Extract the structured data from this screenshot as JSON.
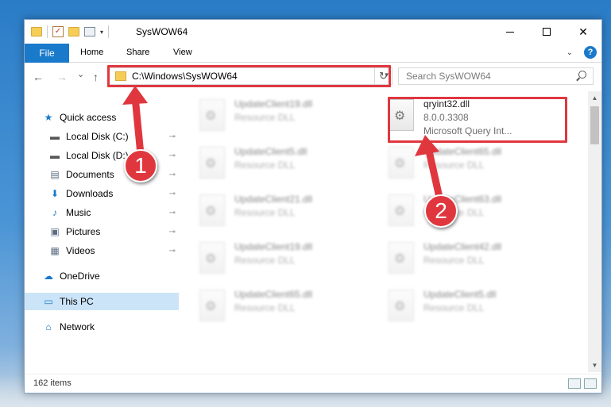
{
  "window": {
    "title": "SysWOW64",
    "minimize_glyph": "—",
    "close_glyph": "✕"
  },
  "ribbon": {
    "tabs": [
      "File",
      "Home",
      "Share",
      "View"
    ],
    "help_label": "?"
  },
  "address_bar": {
    "path": "C:\\Windows\\SysWOW64",
    "refresh_glyph": "↻"
  },
  "nav": {
    "back_glyph": "←",
    "forward_glyph": "→",
    "recent_glyph": "⌄",
    "up_glyph": "↑"
  },
  "search": {
    "placeholder": "Search SysWOW64"
  },
  "sidebar": {
    "items": [
      {
        "label": "Quick access",
        "icon": "star-icon",
        "glyph": "★",
        "color": "#1979ca",
        "pinned": false
      },
      {
        "label": "Local Disk (C:)",
        "icon": "drive-icon",
        "glyph": "▬",
        "color": "#555555",
        "pinned": true
      },
      {
        "label": "Local Disk (D:)",
        "icon": "drive-icon",
        "glyph": "▬",
        "color": "#555555",
        "pinned": true
      },
      {
        "label": "Documents",
        "icon": "documents-icon",
        "glyph": "▤",
        "color": "#5a6e82",
        "pinned": true
      },
      {
        "label": "Downloads",
        "icon": "downloads-icon",
        "glyph": "⬇",
        "color": "#1979ca",
        "pinned": true
      },
      {
        "label": "Music",
        "icon": "music-icon",
        "glyph": "♪",
        "color": "#1979ca",
        "pinned": true
      },
      {
        "label": "Pictures",
        "icon": "pictures-icon",
        "glyph": "▣",
        "color": "#5a6e82",
        "pinned": true
      },
      {
        "label": "Videos",
        "icon": "videos-icon",
        "glyph": "▦",
        "color": "#5a6e82",
        "pinned": true
      },
      {
        "label": "OneDrive",
        "icon": "onedrive-icon",
        "glyph": "☁",
        "color": "#1979ca",
        "pinned": false
      },
      {
        "label": "This PC",
        "icon": "this-pc-icon",
        "glyph": "▭",
        "color": "#1979ca",
        "pinned": false
      },
      {
        "label": "Network",
        "icon": "network-icon",
        "glyph": "⌂",
        "color": "#1979ca",
        "pinned": false
      }
    ],
    "pin_glyph": "📌"
  },
  "files": [
    {
      "name": "UpdateClient19.dll",
      "line2": "Resource DLL",
      "line3": "",
      "blurred": true
    },
    {
      "name": "qryint32.dll",
      "line2": "8.0.0.3308",
      "line3": "Microsoft Query Int...",
      "blurred": false
    },
    {
      "name": "UpdateClient5.dll",
      "line2": "Resource DLL",
      "line3": "",
      "blurred": true
    },
    {
      "name": "UpdateClient65.dll",
      "line2": "Resource DLL",
      "line3": "",
      "blurred": true
    },
    {
      "name": "UpdateClient21.dll",
      "line2": "Resource DLL",
      "line3": "",
      "blurred": true
    },
    {
      "name": "UpdateClient63.dll",
      "line2": "Resource DLL",
      "line3": "",
      "blurred": true
    },
    {
      "name": "UpdateClient19.dll",
      "line2": "Resource DLL",
      "line3": "",
      "blurred": true
    },
    {
      "name": "UpdateClient42.dll",
      "line2": "Resource DLL",
      "line3": "",
      "blurred": true
    },
    {
      "name": "UpdateClient65.dll",
      "line2": "Resource DLL",
      "line3": "",
      "blurred": true
    },
    {
      "name": "UpdateClient5.dll",
      "line2": "Resource DLL",
      "line3": "",
      "blurred": true
    }
  ],
  "status": {
    "item_count": "162 items"
  },
  "annotations": {
    "step1": "1",
    "step2": "2",
    "accent_color": "#e0373f"
  }
}
